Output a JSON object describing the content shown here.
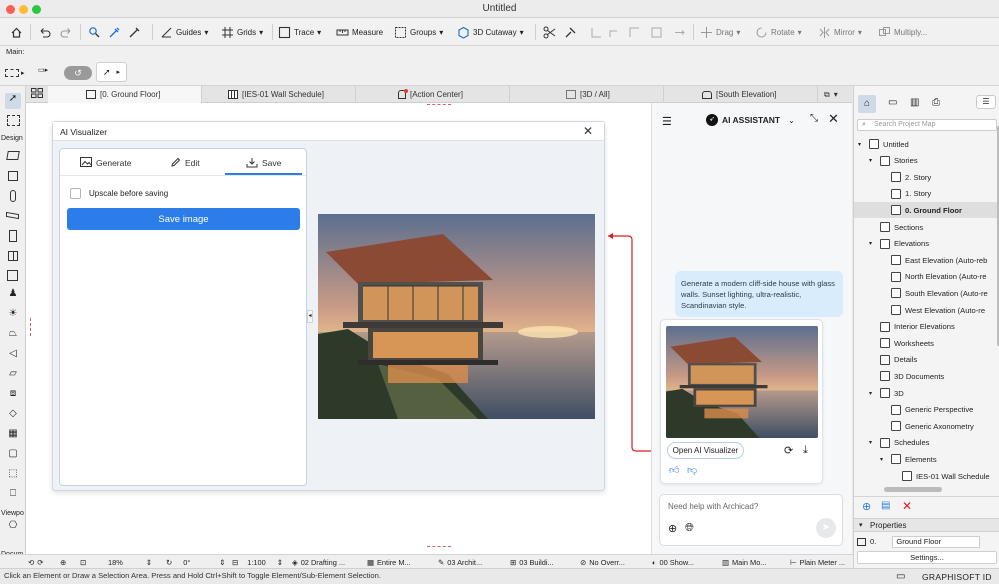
{
  "window": {
    "title": "Untitled"
  },
  "toolbar": {
    "guides": "Guides",
    "grids": "Grids",
    "trace": "Trace",
    "measure": "Measure",
    "groups": "Groups",
    "cutaway": "3D Cutaway",
    "drag": "Drag",
    "rotate": "Rotate",
    "mirror": "Mirror",
    "multiply": "Multiply..."
  },
  "infobox": {
    "label": "Main:"
  },
  "tabs": [
    "[0. Ground Floor]",
    "[IES-01 Wall Schedule]",
    "[Action Center]",
    "[3D / All]",
    "[South Elevation]"
  ],
  "left_toolbox": {
    "design": "Design",
    "viewpoint": "Viewpo",
    "document": "Docum"
  },
  "dialog": {
    "title": "AI Visualizer",
    "tabs": {
      "generate": "Generate",
      "edit": "Edit",
      "save": "Save"
    },
    "upscale_label": "Upscale before saving",
    "save_button": "Save image"
  },
  "assistant": {
    "title": "AI ASSISTANT",
    "prompt": "Generate a modern cliff-side house with glass walls. Sunset lighting, ultra-realistic, Scandinavian style.",
    "open_button": "Open AI Visualizer",
    "input_placeholder": "Need help with Archicad?"
  },
  "navigator": {
    "search_placeholder": "Search Project Map",
    "tree": [
      {
        "label": "Untitled",
        "level": 0
      },
      {
        "label": "Stories",
        "level": 1
      },
      {
        "label": "2. Story",
        "level": 2
      },
      {
        "label": "1. Story",
        "level": 2
      },
      {
        "label": "0. Ground Floor",
        "level": 2,
        "selected": true
      },
      {
        "label": "Sections",
        "level": 1
      },
      {
        "label": "Elevations",
        "level": 1
      },
      {
        "label": "East Elevation (Auto-reb",
        "level": 2
      },
      {
        "label": "North Elevation (Auto-re",
        "level": 2
      },
      {
        "label": "South Elevation (Auto-re",
        "level": 2
      },
      {
        "label": "West Elevation (Auto-re",
        "level": 2
      },
      {
        "label": "Interior Elevations",
        "level": 1
      },
      {
        "label": "Worksheets",
        "level": 1
      },
      {
        "label": "Details",
        "level": 1
      },
      {
        "label": "3D Documents",
        "level": 1
      },
      {
        "label": "3D",
        "level": 1
      },
      {
        "label": "Generic Perspective",
        "level": 2
      },
      {
        "label": "Generic Axonometry",
        "level": 2
      },
      {
        "label": "Schedules",
        "level": 1
      },
      {
        "label": "Elements",
        "level": 2
      },
      {
        "label": "IES-01 Wall Schedule",
        "level": 3
      }
    ],
    "properties_title": "Properties",
    "property_id": "0.",
    "property_value": "Ground Floor",
    "settings_button": "Settings..."
  },
  "statusbar": {
    "zoom": "18%",
    "angle": "0°",
    "scale": "1:100",
    "drafting": "02 Drafting ...",
    "entire": "Entire M...",
    "arch": "03 Archit...",
    "build": "03 Buildi...",
    "override": "No Overr...",
    "show": "00 Show...",
    "model": "Main Mo...",
    "meter": "Plain Meter ..."
  },
  "bottom": {
    "hint": "Click an Element or Draw a Selection Area. Press and Hold Ctrl+Shift to Toggle Element/Sub-Element Selection.",
    "brand": "GRAPHISOFT ID"
  },
  "colors": {
    "accent": "#2b7de9",
    "bubble": "#d8ecfb",
    "arrow": "#d62020"
  }
}
